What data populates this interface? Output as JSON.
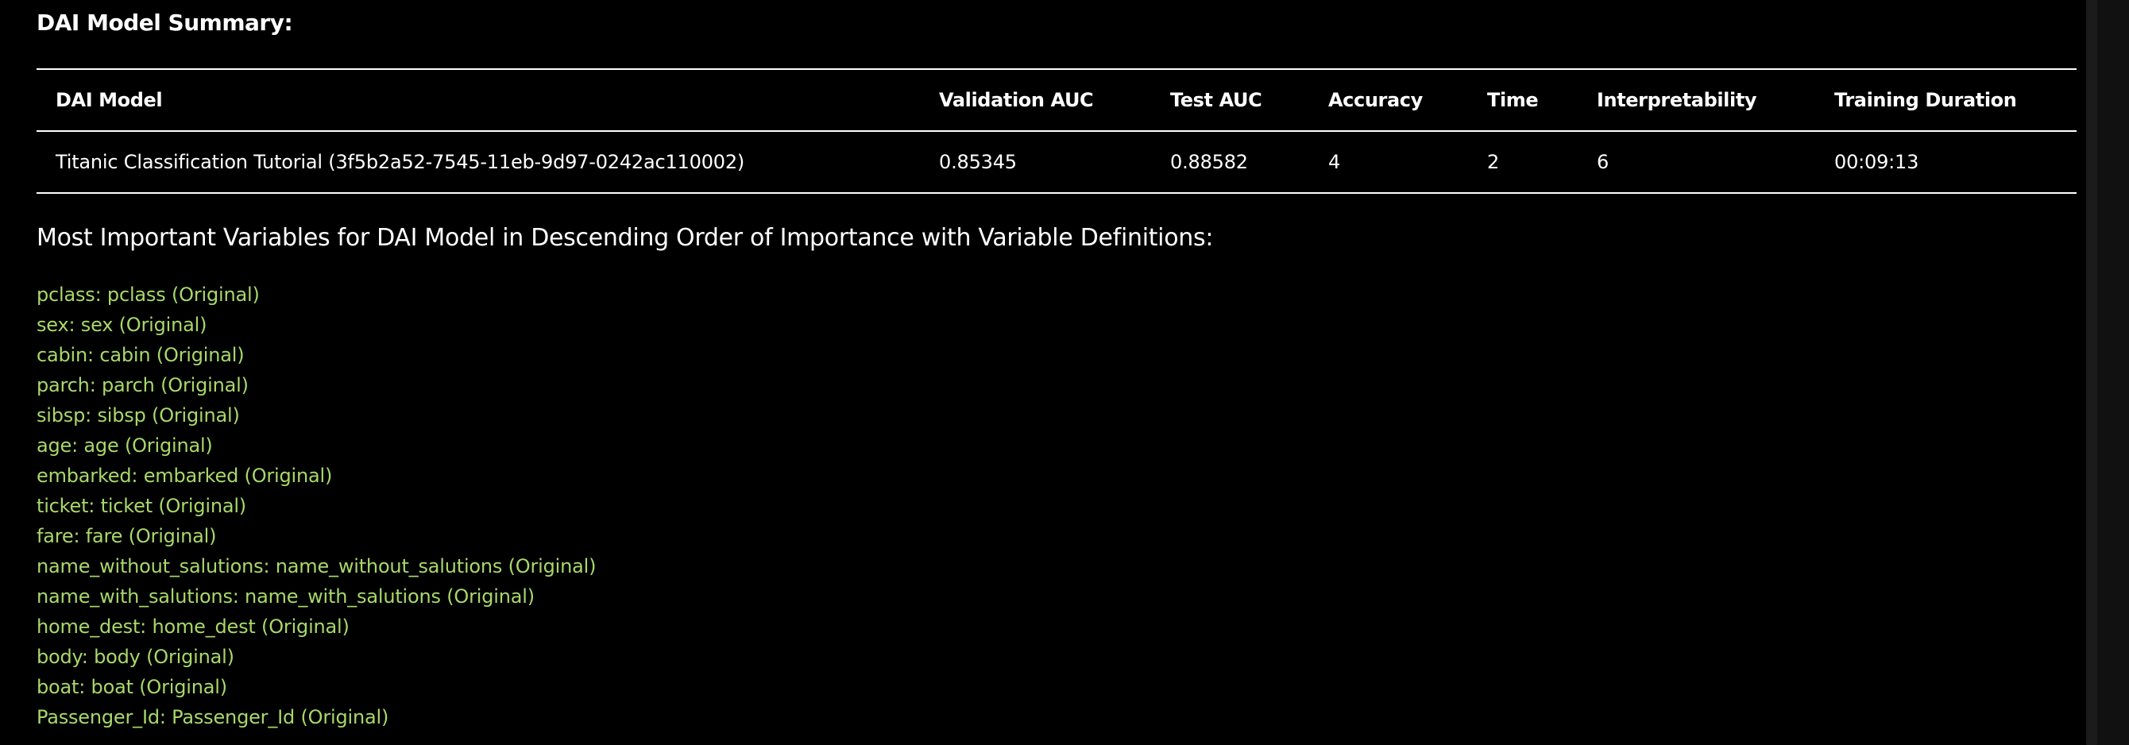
{
  "summary": {
    "title": "DAI Model Summary:"
  },
  "table": {
    "headers": [
      "DAI Model",
      "Validation AUC",
      "Test AUC",
      "Accuracy",
      "Time",
      "Interpretability",
      "Training Duration"
    ],
    "rows": [
      [
        "Titanic Classification Tutorial (3f5b2a52-7545-11eb-9d97-0242ac110002)",
        "0.85345",
        "0.88582",
        "4",
        "2",
        "6",
        "00:09:13"
      ]
    ]
  },
  "importance": {
    "heading": "Most Important Variables for DAI Model in Descending Order of Importance with Variable Definitions:",
    "variables": [
      "pclass: pclass (Original)",
      "sex: sex (Original)",
      "cabin: cabin (Original)",
      "parch: parch (Original)",
      "sibsp: sibsp (Original)",
      "age: age (Original)",
      "embarked: embarked (Original)",
      "ticket: ticket (Original)",
      "fare: fare (Original)",
      "name_without_salutions: name_without_salutions (Original)",
      "name_with_salutions: name_with_salutions (Original)",
      "home_dest: home_dest (Original)",
      "body: body (Original)",
      "boat: boat (Original)",
      "Passenger_Id: Passenger_Id (Original)"
    ]
  },
  "colors": {
    "background": "#000000",
    "text": "#ffffff",
    "variable_text": "#a8d86a"
  }
}
